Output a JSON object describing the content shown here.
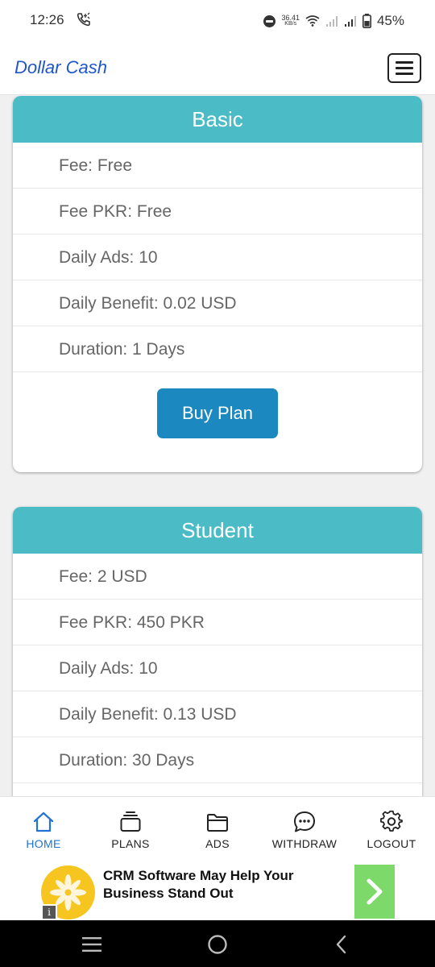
{
  "status_bar": {
    "time": "12:26",
    "net_speed_value": "36.41",
    "net_speed_unit": "KB/s",
    "battery_percent": "45%"
  },
  "header": {
    "brand": "Dollar Cash"
  },
  "plans": [
    {
      "name": "Basic",
      "rows": [
        "Fee: Free",
        "Fee PKR: Free",
        "Daily Ads: 10",
        "Daily Benefit: 0.02 USD",
        "Duration: 1 Days"
      ],
      "buy_label": "Buy Plan"
    },
    {
      "name": "Student",
      "rows": [
        "Fee: 2 USD",
        "Fee PKR: 450 PKR",
        "Daily Ads: 10",
        "Daily Benefit: 0.13 USD",
        "Duration: 30 Days"
      ]
    }
  ],
  "bottom_nav": [
    {
      "label": "HOME",
      "icon": "home-icon",
      "active": true
    },
    {
      "label": "PLANS",
      "icon": "plans-icon",
      "active": false
    },
    {
      "label": "ADS",
      "icon": "folder-icon",
      "active": false
    },
    {
      "label": "WITHDRAW",
      "icon": "chat-icon",
      "active": false
    },
    {
      "label": "LOGOUT",
      "icon": "gear-icon",
      "active": false
    }
  ],
  "ad": {
    "headline": "CRM Software May Help Your Business Stand Out",
    "info_glyph": "i"
  },
  "colors": {
    "accent_teal": "#4bbbc6",
    "button_blue": "#1b88bf",
    "brand_blue": "#1f56c9",
    "nav_active": "#2272d6"
  }
}
